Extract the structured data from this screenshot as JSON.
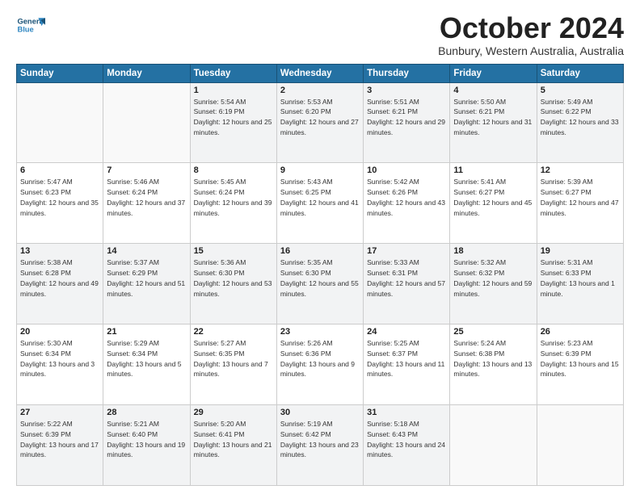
{
  "header": {
    "title": "October 2024",
    "subtitle": "Bunbury, Western Australia, Australia"
  },
  "calendar": {
    "days": [
      "Sunday",
      "Monday",
      "Tuesday",
      "Wednesday",
      "Thursday",
      "Friday",
      "Saturday"
    ]
  },
  "weeks": [
    [
      {
        "day": "",
        "info": ""
      },
      {
        "day": "",
        "info": ""
      },
      {
        "day": "1",
        "info": "Sunrise: 5:54 AM\nSunset: 6:19 PM\nDaylight: 12 hours and 25 minutes."
      },
      {
        "day": "2",
        "info": "Sunrise: 5:53 AM\nSunset: 6:20 PM\nDaylight: 12 hours and 27 minutes."
      },
      {
        "day": "3",
        "info": "Sunrise: 5:51 AM\nSunset: 6:21 PM\nDaylight: 12 hours and 29 minutes."
      },
      {
        "day": "4",
        "info": "Sunrise: 5:50 AM\nSunset: 6:21 PM\nDaylight: 12 hours and 31 minutes."
      },
      {
        "day": "5",
        "info": "Sunrise: 5:49 AM\nSunset: 6:22 PM\nDaylight: 12 hours and 33 minutes."
      }
    ],
    [
      {
        "day": "6",
        "info": "Sunrise: 5:47 AM\nSunset: 6:23 PM\nDaylight: 12 hours and 35 minutes."
      },
      {
        "day": "7",
        "info": "Sunrise: 5:46 AM\nSunset: 6:24 PM\nDaylight: 12 hours and 37 minutes."
      },
      {
        "day": "8",
        "info": "Sunrise: 5:45 AM\nSunset: 6:24 PM\nDaylight: 12 hours and 39 minutes."
      },
      {
        "day": "9",
        "info": "Sunrise: 5:43 AM\nSunset: 6:25 PM\nDaylight: 12 hours and 41 minutes."
      },
      {
        "day": "10",
        "info": "Sunrise: 5:42 AM\nSunset: 6:26 PM\nDaylight: 12 hours and 43 minutes."
      },
      {
        "day": "11",
        "info": "Sunrise: 5:41 AM\nSunset: 6:27 PM\nDaylight: 12 hours and 45 minutes."
      },
      {
        "day": "12",
        "info": "Sunrise: 5:39 AM\nSunset: 6:27 PM\nDaylight: 12 hours and 47 minutes."
      }
    ],
    [
      {
        "day": "13",
        "info": "Sunrise: 5:38 AM\nSunset: 6:28 PM\nDaylight: 12 hours and 49 minutes."
      },
      {
        "day": "14",
        "info": "Sunrise: 5:37 AM\nSunset: 6:29 PM\nDaylight: 12 hours and 51 minutes."
      },
      {
        "day": "15",
        "info": "Sunrise: 5:36 AM\nSunset: 6:30 PM\nDaylight: 12 hours and 53 minutes."
      },
      {
        "day": "16",
        "info": "Sunrise: 5:35 AM\nSunset: 6:30 PM\nDaylight: 12 hours and 55 minutes."
      },
      {
        "day": "17",
        "info": "Sunrise: 5:33 AM\nSunset: 6:31 PM\nDaylight: 12 hours and 57 minutes."
      },
      {
        "day": "18",
        "info": "Sunrise: 5:32 AM\nSunset: 6:32 PM\nDaylight: 12 hours and 59 minutes."
      },
      {
        "day": "19",
        "info": "Sunrise: 5:31 AM\nSunset: 6:33 PM\nDaylight: 13 hours and 1 minute."
      }
    ],
    [
      {
        "day": "20",
        "info": "Sunrise: 5:30 AM\nSunset: 6:34 PM\nDaylight: 13 hours and 3 minutes."
      },
      {
        "day": "21",
        "info": "Sunrise: 5:29 AM\nSunset: 6:34 PM\nDaylight: 13 hours and 5 minutes."
      },
      {
        "day": "22",
        "info": "Sunrise: 5:27 AM\nSunset: 6:35 PM\nDaylight: 13 hours and 7 minutes."
      },
      {
        "day": "23",
        "info": "Sunrise: 5:26 AM\nSunset: 6:36 PM\nDaylight: 13 hours and 9 minutes."
      },
      {
        "day": "24",
        "info": "Sunrise: 5:25 AM\nSunset: 6:37 PM\nDaylight: 13 hours and 11 minutes."
      },
      {
        "day": "25",
        "info": "Sunrise: 5:24 AM\nSunset: 6:38 PM\nDaylight: 13 hours and 13 minutes."
      },
      {
        "day": "26",
        "info": "Sunrise: 5:23 AM\nSunset: 6:39 PM\nDaylight: 13 hours and 15 minutes."
      }
    ],
    [
      {
        "day": "27",
        "info": "Sunrise: 5:22 AM\nSunset: 6:39 PM\nDaylight: 13 hours and 17 minutes."
      },
      {
        "day": "28",
        "info": "Sunrise: 5:21 AM\nSunset: 6:40 PM\nDaylight: 13 hours and 19 minutes."
      },
      {
        "day": "29",
        "info": "Sunrise: 5:20 AM\nSunset: 6:41 PM\nDaylight: 13 hours and 21 minutes."
      },
      {
        "day": "30",
        "info": "Sunrise: 5:19 AM\nSunset: 6:42 PM\nDaylight: 13 hours and 23 minutes."
      },
      {
        "day": "31",
        "info": "Sunrise: 5:18 AM\nSunset: 6:43 PM\nDaylight: 13 hours and 24 minutes."
      },
      {
        "day": "",
        "info": ""
      },
      {
        "day": "",
        "info": ""
      }
    ]
  ]
}
